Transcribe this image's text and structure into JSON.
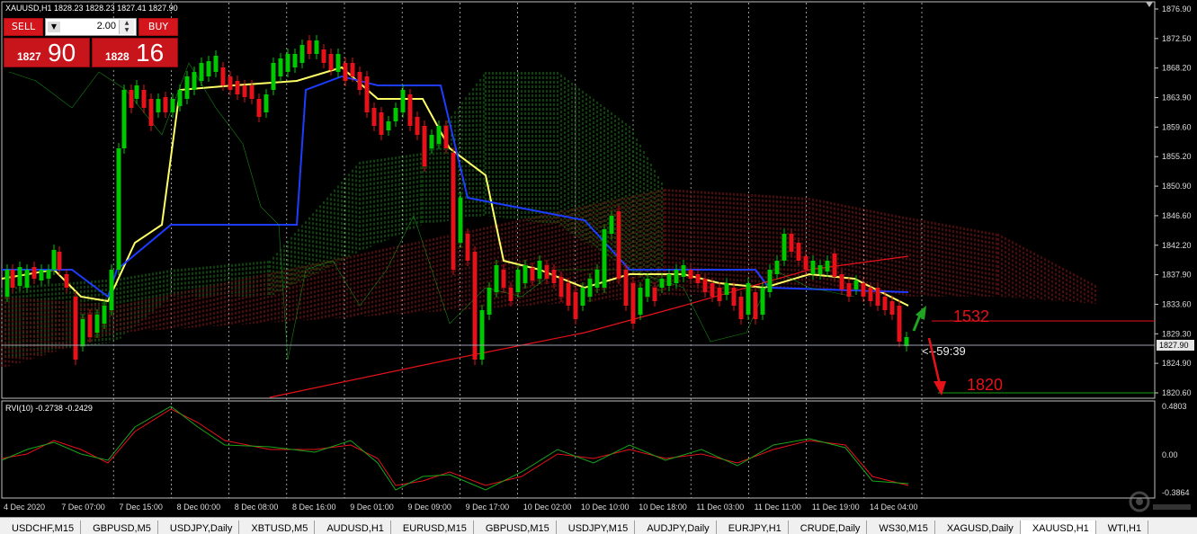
{
  "window": {
    "symbol_header": "XAUUSD,H1  1828.23 1828.23 1827.41 1827.90",
    "indicator_header": "RVI(10) -0.2738 -0.2429"
  },
  "trade_panel": {
    "sell_label": "SELL",
    "buy_label": "BUY",
    "lot_value": "2.00",
    "sell_price_prefix": "1827",
    "sell_price_big": "90",
    "buy_price_prefix": "1828",
    "buy_price_big": "16"
  },
  "price_axis": {
    "labels": [
      "1876.90",
      "1872.50",
      "1868.20",
      "1863.90",
      "1859.60",
      "1855.20",
      "1850.90",
      "1846.60",
      "1842.20",
      "1837.90",
      "1833.60",
      "1829.30",
      "1824.90",
      "1820.60"
    ],
    "current_price": "1827.90",
    "color_up": "#00c800",
    "color_down": "#e6121a"
  },
  "indicator_axis": {
    "labels": [
      "0.4803",
      "0.00",
      "-0.3864"
    ]
  },
  "time_axis": {
    "labels": [
      "4 Dec 2020",
      "7 Dec 07:00",
      "7 Dec 15:00",
      "8 Dec 00:00",
      "8 Dec 08:00",
      "8 Dec 16:00",
      "9 Dec 01:00",
      "9 Dec 09:00",
      "9 Dec 17:00",
      "10 Dec 02:00",
      "10 Dec 10:00",
      "10 Dec 18:00",
      "11 Dec 03:00",
      "11 Dec 11:00",
      "11 Dec 19:00",
      "14 Dec 04:00"
    ]
  },
  "annotations": {
    "countdown": "<--59:39",
    "level_upper": "1532",
    "level_lower": "1820"
  },
  "tabs": [
    {
      "label": "USDCHF,M15",
      "active": false
    },
    {
      "label": "GBPUSD,M5",
      "active": false
    },
    {
      "label": "USDJPY,Daily",
      "active": false
    },
    {
      "label": "XBTUSD,M5",
      "active": false
    },
    {
      "label": "AUDUSD,H1",
      "active": false
    },
    {
      "label": "EURUSD,M15",
      "active": false
    },
    {
      "label": "GBPUSD,M15",
      "active": false
    },
    {
      "label": "USDJPY,M15",
      "active": false
    },
    {
      "label": "AUDJPY,Daily",
      "active": false
    },
    {
      "label": "EURJPY,H1",
      "active": false
    },
    {
      "label": "CRUDE,Daily",
      "active": false
    },
    {
      "label": "WS30,M15",
      "active": false
    },
    {
      "label": "XAGUSD,Daily",
      "active": false
    },
    {
      "label": "XAUUSD,H1",
      "active": true
    },
    {
      "label": "WTI,H1",
      "active": false
    }
  ]
}
